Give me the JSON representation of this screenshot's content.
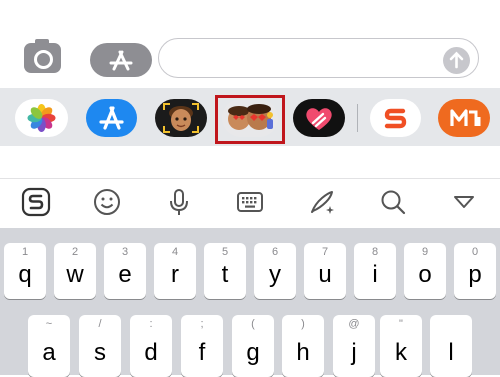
{
  "composer": {
    "camera_icon": "camera-icon",
    "appstore_icon": "app-store-icon",
    "message_value": "",
    "send_icon": "arrow-up-icon"
  },
  "app_strip": {
    "apps": [
      "photos",
      "app-store",
      "memoji",
      "memoji-stickers",
      "digital-touch",
      "sogou-input",
      "mango-tv"
    ],
    "highlight_color": "#c0161c"
  },
  "keyboard_toolbar": {
    "items": [
      "sogou-logo-icon",
      "emoji-icon",
      "microphone-icon",
      "keyboard-icon",
      "handwriting-icon",
      "search-icon",
      "collapse-icon"
    ]
  },
  "keyboard": {
    "row1": [
      {
        "main": "q",
        "alt": "1"
      },
      {
        "main": "w",
        "alt": "2"
      },
      {
        "main": "e",
        "alt": "3"
      },
      {
        "main": "r",
        "alt": "4"
      },
      {
        "main": "t",
        "alt": "5"
      },
      {
        "main": "y",
        "alt": "6"
      },
      {
        "main": "u",
        "alt": "7"
      },
      {
        "main": "i",
        "alt": "8"
      },
      {
        "main": "o",
        "alt": "9"
      },
      {
        "main": "p",
        "alt": "0"
      }
    ],
    "row2": [
      {
        "main": "a",
        "alt": "~"
      },
      {
        "main": "s",
        "alt": "/"
      },
      {
        "main": "d",
        "alt": ":"
      },
      {
        "main": "f",
        "alt": ";"
      },
      {
        "main": "g",
        "alt": "("
      },
      {
        "main": "h",
        "alt": ")"
      },
      {
        "main": "j",
        "alt": "@"
      },
      {
        "main": "k",
        "alt": "\""
      },
      {
        "main": "l",
        "alt": ""
      }
    ]
  },
  "colors": {
    "appstore_blue": "#1e88f0",
    "mango_orange": "#ef6a1f",
    "sogou_orange": "#f04f24"
  }
}
